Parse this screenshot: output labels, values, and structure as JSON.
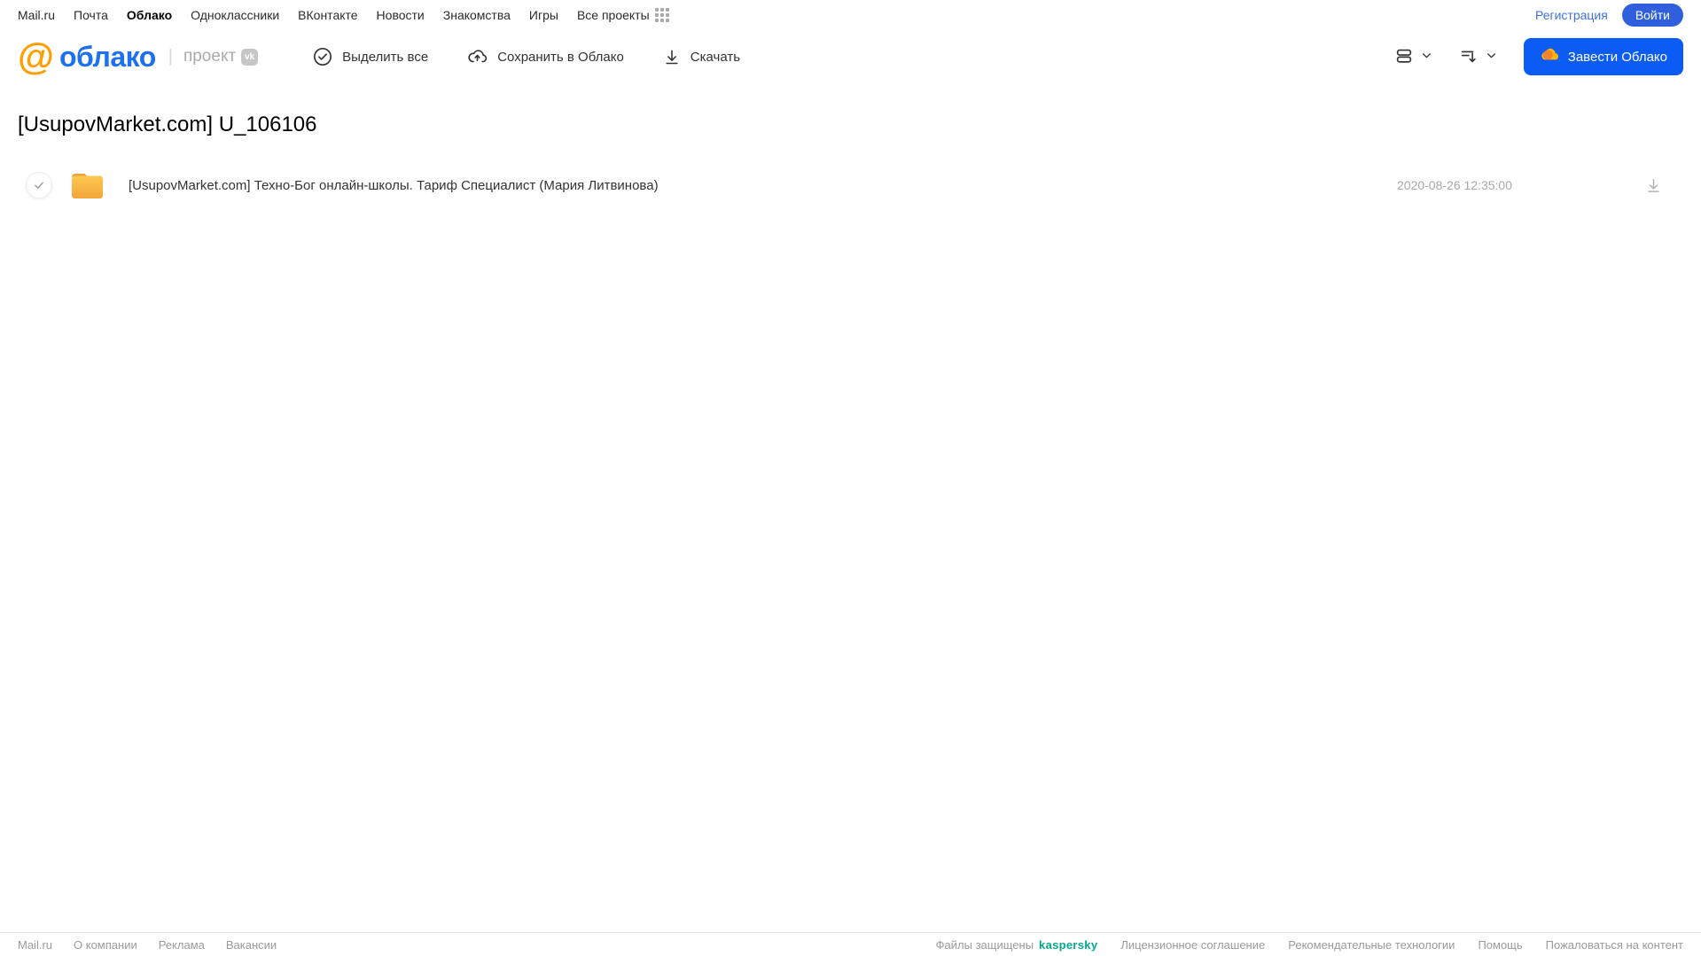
{
  "top_nav": {
    "links": [
      "Mail.ru",
      "Почта",
      "Облако",
      "Одноклассники",
      "ВКонтакте",
      "Новости",
      "Знакомства",
      "Игры",
      "Все проекты"
    ],
    "registration_label": "Регистрация",
    "login_label": "Войти"
  },
  "header": {
    "logo_at": "@",
    "logo_text": "облако",
    "project_label": "проект",
    "vk_badge": "vk",
    "select_all_label": "Выделить все",
    "save_to_cloud_label": "Сохранить в Облако",
    "download_label": "Скачать",
    "create_cloud_label": "Завести Облако"
  },
  "main": {
    "title": "[UsupovMarket.com] U_106106",
    "file": {
      "type": "folder",
      "name": "[UsupovMarket.com] Техно-Бог онлайн-школы. Тариф Специалист (Мария Литвинова)",
      "date": "2020-08-26 12:35:00"
    }
  },
  "footer": {
    "links_left": [
      "Mail.ru",
      "О компании",
      "Реклама",
      "Вакансии"
    ],
    "protected_label": "Файлы защищены",
    "kaspersky_label": "kaspersky",
    "links_right": [
      "Лицензионное соглашение",
      "Рекомендательные технологии",
      "Помощь",
      "Пожаловаться на контент"
    ]
  },
  "colors": {
    "accent_blue": "#0b5cf5",
    "logo_blue": "#1e70f0",
    "logo_orange": "#ff9e00",
    "kaspersky_green": "#00a88e",
    "folder_yellow": "#f5a83c",
    "muted_gray": "#a9a9a9"
  }
}
